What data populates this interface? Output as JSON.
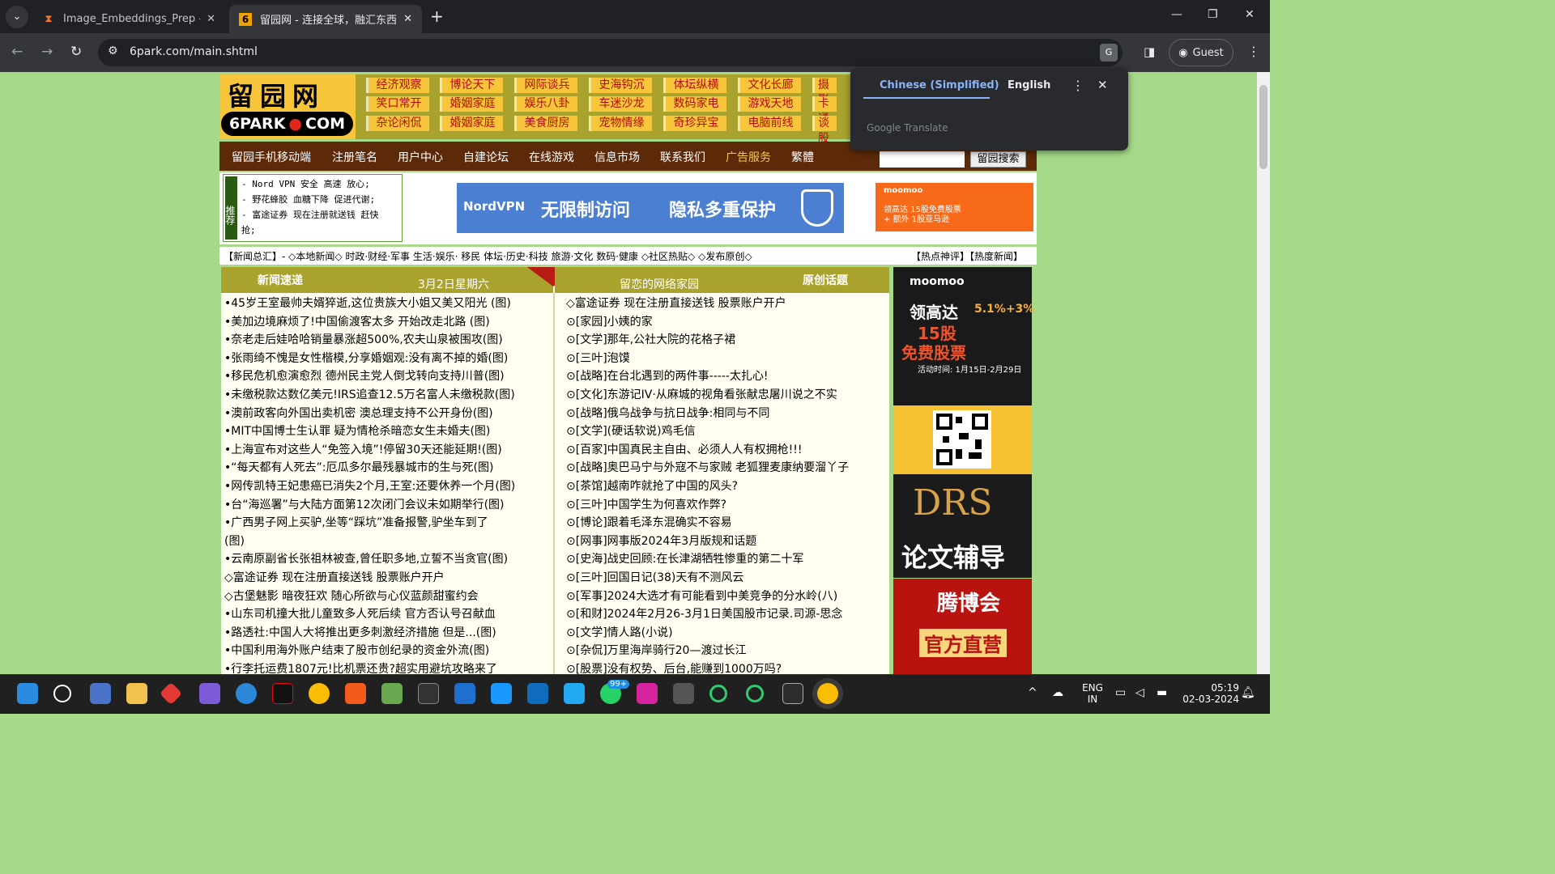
{
  "browser": {
    "tabs": [
      {
        "title": "Image_Embeddings_Prep - Jupy",
        "favicon": "hourglass"
      },
      {
        "title": "留园网 - 连接全球，融汇东西 6",
        "favicon": "6"
      }
    ],
    "url": "6park.com/main.shtml",
    "profile_label": "Guest"
  },
  "translate": {
    "lang_source": "Chinese (Simplified)",
    "lang_target": "English",
    "footer": "Google Translate"
  },
  "site": {
    "logo_cn": "留园网",
    "logo_en_left": "6PARK",
    "logo_en_right": "COM",
    "menu_rows": [
      [
        "经济观察",
        "博论天下",
        "网际谈兵",
        "史海钩沉",
        "体坛纵横",
        "文化长廊",
        "摄影"
      ],
      [
        "笑口常开",
        "婚姻家庭",
        "娱乐八卦",
        "车迷沙龙",
        "数码家电",
        "游戏天地",
        "卡通"
      ],
      [
        "杂论闲侃",
        "婚姻家庭",
        "美食厨房",
        "宠物情缘",
        "奇珍异宝",
        "电脑前线",
        "谈股"
      ]
    ],
    "nav": [
      "留园手机移动端",
      "注册笔名",
      "用户中心",
      "自建论坛",
      "在线游戏",
      "信息市场",
      "联系我们",
      "广告服务",
      "繁體"
    ],
    "search_button": "留园搜索",
    "recommend_label": "推荐",
    "recommend": [
      "- Nord VPN 安全 高速 放心;",
      "- 野花蜂胶 血糖下降 促进代谢;",
      "- 富途证券 现在注册就送钱 赶快",
      "抢;"
    ],
    "nord_ad": {
      "brand": "NordVPN",
      "text1": "无限制访问",
      "text2": "隐私多重保护"
    },
    "moomoo_small": {
      "brand": "moomoo",
      "line1": "领高达 15股免费股票",
      "line2": "+ 额外 1股亚马逊"
    },
    "category_bar_left": "【新闻总汇】- ◇本地新闻◇ 时政·财经·军事 生活·娱乐· 移民 体坛·历史·科技 旅游·文化 数码·健康 ◇社区热贴◇ ◇发布原创◇",
    "category_bar_right": "【热点神评】【热度新闻】",
    "section_news": "新闻速递",
    "section_date": "3月2日星期六",
    "section_home": "留恋的网络家园",
    "section_original": "原创话题",
    "news_left": [
      "•45岁王室最帅夫婿猝逝,这位贵族大小姐又美又阳光 (图)",
      "•美加边境麻烦了!中国偷渡客太多 开始改走北路 (图)",
      "•奈老走后娃哈哈销量暴涨超500%,农夫山泉被围攻(图)",
      "•张雨绮不愧是女性楷模,分享婚姻观:没有离不掉的婚(图)",
      "•移民危机愈演愈烈 德州民主党人倒戈转向支持川普(图)",
      "•未缴税款达数亿美元!IRS追查12.5万名富人未缴税款(图)",
      "•澳前政客向外国出卖机密 澳总理支持不公开身份(图)",
      "•MIT中国博士生认罪 疑为情枪杀暗恋女生未婚夫(图)",
      "•上海宣布对这些人“免签入境”!停留30天还能延期!(图)",
      "•“每天都有人死去”:厄瓜多尔最残暴城市的生与死(图)",
      "•网传凯特王妃患癌已消失2个月,王室:还要休养一个月(图)",
      "•台“海巡署”与大陆方面第12次闭门会议未如期举行(图)",
      "•广西男子网上买驴,坐等“踩坑”准备报警,驴坐车到了",
      "(图)",
      "•云南原副省长张祖林被查,曾任职多地,立誓不当贪官(图)",
      "◇富途证券 现在注册直接送钱 股票账户开户",
      "◇古堡魅影 暗夜狂欢 随心所欲与心仪蓝颜甜蜜约会",
      "•山东司机撞大批儿童致多人死后续 官方否认号召献血",
      "•路透社:中国人大将推出更多刺激经济措施 但是...(图)",
      "•中国利用海外账户结束了股市创纪录的资金外流(图)",
      "•行李托运费1807元!比机票还贵?超实用避坑攻略来了"
    ],
    "news_right": [
      "◇富途证券 现在注册直接送钱 股票账户开户",
      "⊙[家园]小姨的家",
      "⊙[文学]那年,公社大院的花格子裙",
      "⊙[三叶]泡馍",
      "⊙[战略]在台北遇到的两件事-----太扎心!",
      "⊙[文化]东游记IV·从麻城的视角看张献忠屠川说之不实",
      "⊙[战略]俄乌战争与抗日战争:相同与不同",
      "⊙[文学](硬话软说)鸡毛信",
      "⊙[百家]中国真民主自由、必须人人有权拥枪!!!",
      "⊙[战略]奥巴马宁与外寇不与家贼 老狐狸麦康纳要溜丫子",
      "⊙[茶馆]越南咋就抢了中国的风头?",
      "⊙[三叶]中国学生为何喜欢作弊?",
      "⊙[博论]跟着毛泽东混确实不容易",
      "⊙[网事]网事版2024年3月版规和话题",
      "⊙[史海]战史回顾:在长津湖牺牲惨重的第二十军",
      "⊙[三叶]回国日记(38)天有不测风云",
      "⊙[军事]2024大选才有可能看到中美竞争的分水岭(八)",
      "⊙[和财]2024年2月26-3月1日美国股市记录.司源-思念",
      "⊙[文学]情人路(小说)",
      "⊙[杂侃]万里海岸骑行20—渡过长江",
      "⊙[股票]没有权势、后台,能赚到1000万吗?"
    ],
    "ads_side": {
      "moomoo_brand": "moomoo",
      "moomoo_line1": "领高达",
      "moomoo_line2": "15股",
      "moomoo_line3": "免费股票",
      "moomoo_pct": "5.1%+3%",
      "moomoo_date": "活动时间: 1月15日-2月29日",
      "drs_logo": "DRS",
      "drs_text": "论文辅导",
      "tbh_name": "腾博会",
      "tbh_text": "官方直营"
    }
  },
  "taskbar": {
    "lang_line1": "ENG",
    "lang_line2": "IN",
    "time": "05:19",
    "date": "02-03-2024",
    "whatsapp_badge": "99+"
  },
  "colors": {
    "page_bg": "#a6d98a",
    "olive": "#a9a32e",
    "nav_brown": "#5d2a09",
    "menu_yellow": "#f7c53a",
    "menu_text": "#b10d0d"
  }
}
